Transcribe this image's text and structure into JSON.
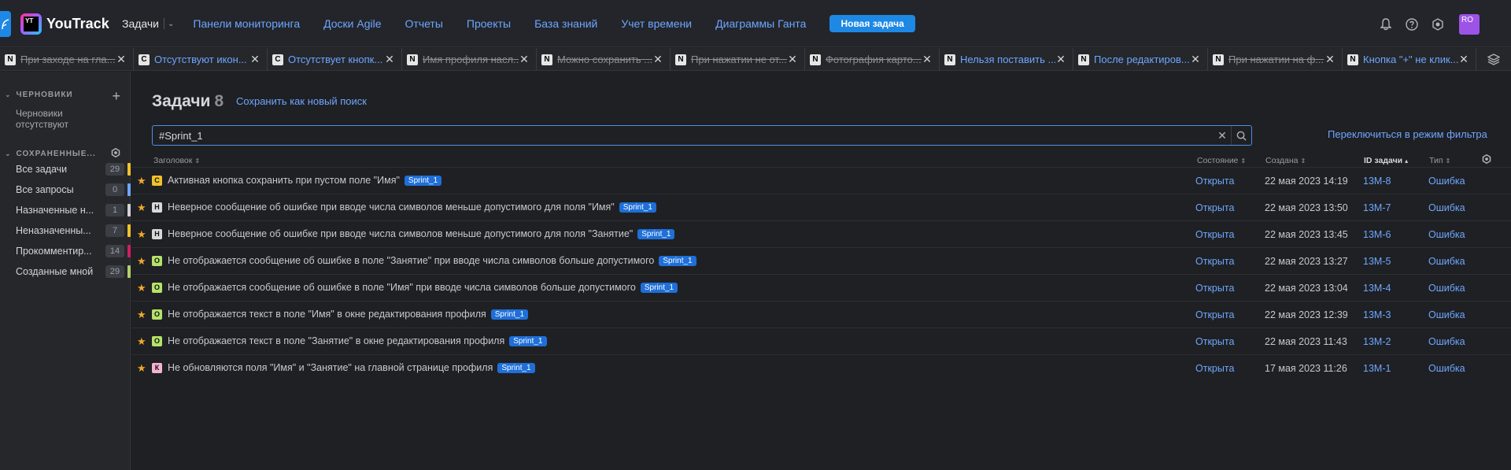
{
  "app": {
    "name": "YouTrack",
    "logo_letters": "YT"
  },
  "colors": {
    "accent": "#1e88e5",
    "link": "#6ea6ff",
    "star": "#f0a92a"
  },
  "nav": {
    "issues": "Задачи",
    "items": [
      "Панели мониторинга",
      "Доски Agile",
      "Отчеты",
      "Проекты",
      "База знаний",
      "Учет времени",
      "Диаграммы Ганта"
    ],
    "new_issue": "Новая задача"
  },
  "user": {
    "avatar_text": "RO"
  },
  "tabs": [
    {
      "badge": "N",
      "title": "При заходе на гла...",
      "state": "resolved"
    },
    {
      "badge": "C",
      "title": "Отсутствуют икон...",
      "state": "active"
    },
    {
      "badge": "C",
      "title": "Отсутствует кнопк...",
      "state": "active"
    },
    {
      "badge": "N",
      "title": "Имя профиля насл...",
      "state": "resolved"
    },
    {
      "badge": "N",
      "title": "Можно сохранить ...",
      "state": "resolved"
    },
    {
      "badge": "N",
      "title": "При нажатии не от...",
      "state": "resolved"
    },
    {
      "badge": "N",
      "title": "Фотография карто...",
      "state": "resolved"
    },
    {
      "badge": "N",
      "title": "Нельзя поставить ...",
      "state": "active"
    },
    {
      "badge": "N",
      "title": "После редактиров...",
      "state": "active"
    },
    {
      "badge": "N",
      "title": "При нажатии на ф...",
      "state": "resolved"
    },
    {
      "badge": "N",
      "title": "Кнопка \"+\" не клик...",
      "state": "active"
    }
  ],
  "sidebar": {
    "drafts_title": "ЧЕРНОВИКИ",
    "drafts_empty": "Черновики отсутствуют",
    "saved_title": "СОХРАНЕННЫЕ...",
    "items": [
      {
        "label": "Все задачи",
        "count": "29",
        "color": "#f0c22a"
      },
      {
        "label": "Все запросы",
        "count": "0",
        "color": "#6ea6ff"
      },
      {
        "label": "Назначенные н...",
        "count": "1",
        "color": "#d0d2d6"
      },
      {
        "label": "Неназначенны...",
        "count": "7",
        "color": "#f0c22a"
      },
      {
        "label": "Прокомментир...",
        "count": "14",
        "color": "#d01e64"
      },
      {
        "label": "Созданные мной",
        "count": "29",
        "color": "#b5cf6a"
      }
    ]
  },
  "main": {
    "title": "Задачи",
    "count": "8",
    "save_search": "Сохранить как новый поиск",
    "search_value": "#Sprint_1",
    "filter_mode": "Переключиться в режим фильтра",
    "columns": {
      "summary": "Заголовок",
      "state": "Состояние",
      "created": "Создана",
      "id": "ID задачи",
      "type": "Тип"
    }
  },
  "issues": [
    {
      "priority": "C",
      "prio_color": "#f0c22a",
      "summary": "Активная кнопка сохранить при пустом поле \"Имя\"",
      "tag": "Sprint_1",
      "state": "Открыта",
      "created": "22 мая 2023 14:19",
      "id": "13M-8",
      "type": "Ошибка"
    },
    {
      "priority": "Н",
      "prio_color": "#d8d8d8",
      "summary": "Неверное сообщение об ошибке при вводе числа символов меньше допустимого для поля \"Имя\"",
      "tag": "Sprint_1",
      "state": "Открыта",
      "created": "22 мая 2023 13:50",
      "id": "13M-7",
      "type": "Ошибка"
    },
    {
      "priority": "Н",
      "prio_color": "#d8d8d8",
      "summary": "Неверное сообщение об ошибке при вводе числа символов меньше допустимого для поля \"Занятие\"",
      "tag": "Sprint_1",
      "state": "Открыта",
      "created": "22 мая 2023 13:45",
      "id": "13M-6",
      "type": "Ошибка"
    },
    {
      "priority": "О",
      "prio_color": "#b5e26a",
      "summary": "Не отображается сообщение об ошибке в поле \"Занятие\" при вводе числа символов больше допустимого",
      "tag": "Sprint_1",
      "state": "Открыта",
      "created": "22 мая 2023 13:27",
      "id": "13M-5",
      "type": "Ошибка"
    },
    {
      "priority": "О",
      "prio_color": "#b5e26a",
      "summary": "Не отображается сообщение об ошибке в поле \"Имя\" при вводе числа символов больше допустимого",
      "tag": "Sprint_1",
      "state": "Открыта",
      "created": "22 мая 2023 13:04",
      "id": "13M-4",
      "type": "Ошибка"
    },
    {
      "priority": "О",
      "prio_color": "#b5e26a",
      "summary": "Не отображается текст в поле \"Имя\" в окне редактирования профиля",
      "tag": "Sprint_1",
      "state": "Открыта",
      "created": "22 мая 2023 12:39",
      "id": "13M-3",
      "type": "Ошибка"
    },
    {
      "priority": "О",
      "prio_color": "#b5e26a",
      "summary": "Не отображается текст в поле \"Занятие\" в окне редактирования профиля",
      "tag": "Sprint_1",
      "state": "Открыта",
      "created": "22 мая 2023 11:43",
      "id": "13M-2",
      "type": "Ошибка"
    },
    {
      "priority": "К",
      "prio_color": "#f5b3d3",
      "summary": "Не обновляются поля \"Имя\" и \"Занятие\" на главной странице профиля",
      "tag": "Sprint_1",
      "state": "Открыта",
      "created": "17 мая 2023 11:26",
      "id": "13M-1",
      "type": "Ошибка"
    }
  ]
}
